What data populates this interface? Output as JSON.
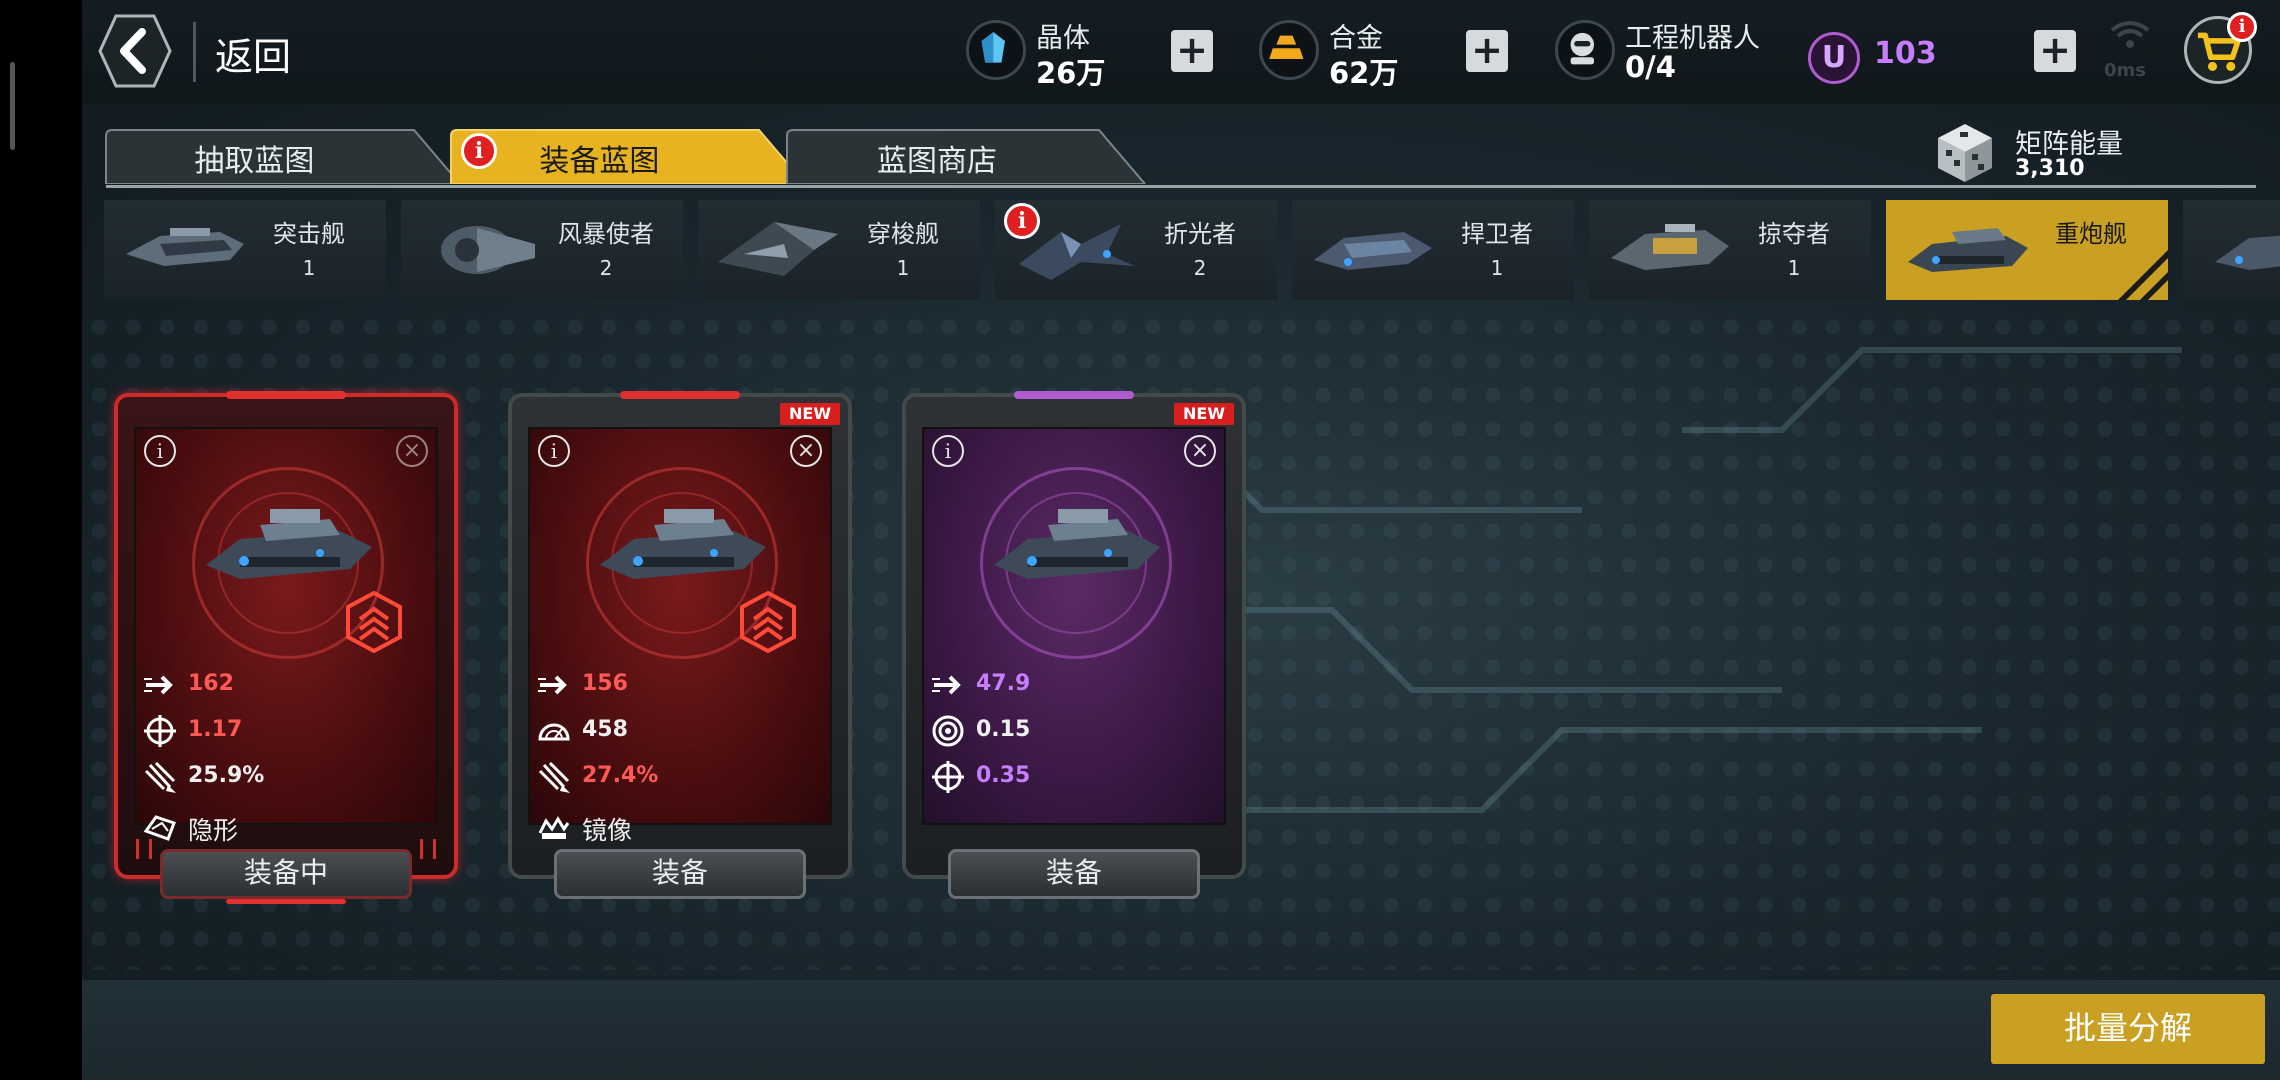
{
  "header": {
    "back_label": "返回",
    "resources": [
      {
        "name": "晶体",
        "value": "26万",
        "icon": "crystal-icon"
      },
      {
        "name": "合金",
        "value": "62万",
        "icon": "alloy-icon"
      },
      {
        "name": "工程机器人",
        "value": "0/4",
        "icon": "robot-icon"
      }
    ],
    "currency": {
      "symbol": "U",
      "value": "103",
      "icon": "u-currency-icon"
    },
    "ping": "0ms",
    "shop_icon": "cart-icon"
  },
  "tabs": [
    {
      "label": "抽取蓝图",
      "active": false
    },
    {
      "label": "装备蓝图",
      "active": true,
      "badge": "i"
    },
    {
      "label": "蓝图商店",
      "active": false
    }
  ],
  "matrix_energy": {
    "name": "矩阵能量",
    "value": "3,310"
  },
  "categories": [
    {
      "name": "突击舰",
      "count": "1"
    },
    {
      "name": "风暴使者",
      "count": "2"
    },
    {
      "name": "穿梭舰",
      "count": "1"
    },
    {
      "name": "折光者",
      "count": "2",
      "badge": "i"
    },
    {
      "name": "捍卫者",
      "count": "1"
    },
    {
      "name": "掠夺者",
      "count": "1"
    },
    {
      "name": "重炮舰",
      "count": "",
      "active": true
    }
  ],
  "cards": [
    {
      "rarity": "red",
      "equipped": true,
      "new": false,
      "stats": [
        {
          "icon": "speed-arrow-icon",
          "value": "162",
          "color": "#ff5a55"
        },
        {
          "icon": "crosshair-icon",
          "value": "1.17",
          "color": "#ff5a55"
        },
        {
          "icon": "missile-icon",
          "value": "25.9%",
          "color": "#f0f0f0"
        }
      ],
      "ability": {
        "icon": "stealth-icon",
        "label": "隐形"
      },
      "button": "装备中"
    },
    {
      "rarity": "red",
      "equipped": false,
      "new": true,
      "stats": [
        {
          "icon": "speed-arrow-icon",
          "value": "156",
          "color": "#ff5a55"
        },
        {
          "icon": "radar-icon",
          "value": "458",
          "color": "#f0f0f0"
        },
        {
          "icon": "missile-icon",
          "value": "27.4%",
          "color": "#ff5a55"
        }
      ],
      "ability": {
        "icon": "mirror-icon",
        "label": "镜像"
      },
      "button": "装备"
    },
    {
      "rarity": "purple",
      "equipped": false,
      "new": true,
      "stats": [
        {
          "icon": "speed-arrow-icon",
          "value": "47.9",
          "color": "#c77dff"
        },
        {
          "icon": "shield-disc-icon",
          "value": "0.15",
          "color": "#f0f0f0"
        },
        {
          "icon": "crosshair-icon",
          "value": "0.35",
          "color": "#c77dff"
        }
      ],
      "ability": null,
      "button": "装备"
    }
  ],
  "new_label": "NEW",
  "batch_button": "批量分解",
  "colors": {
    "gold": "#c9a022",
    "red": "#d02a2a",
    "purple": "#b05cd0"
  }
}
